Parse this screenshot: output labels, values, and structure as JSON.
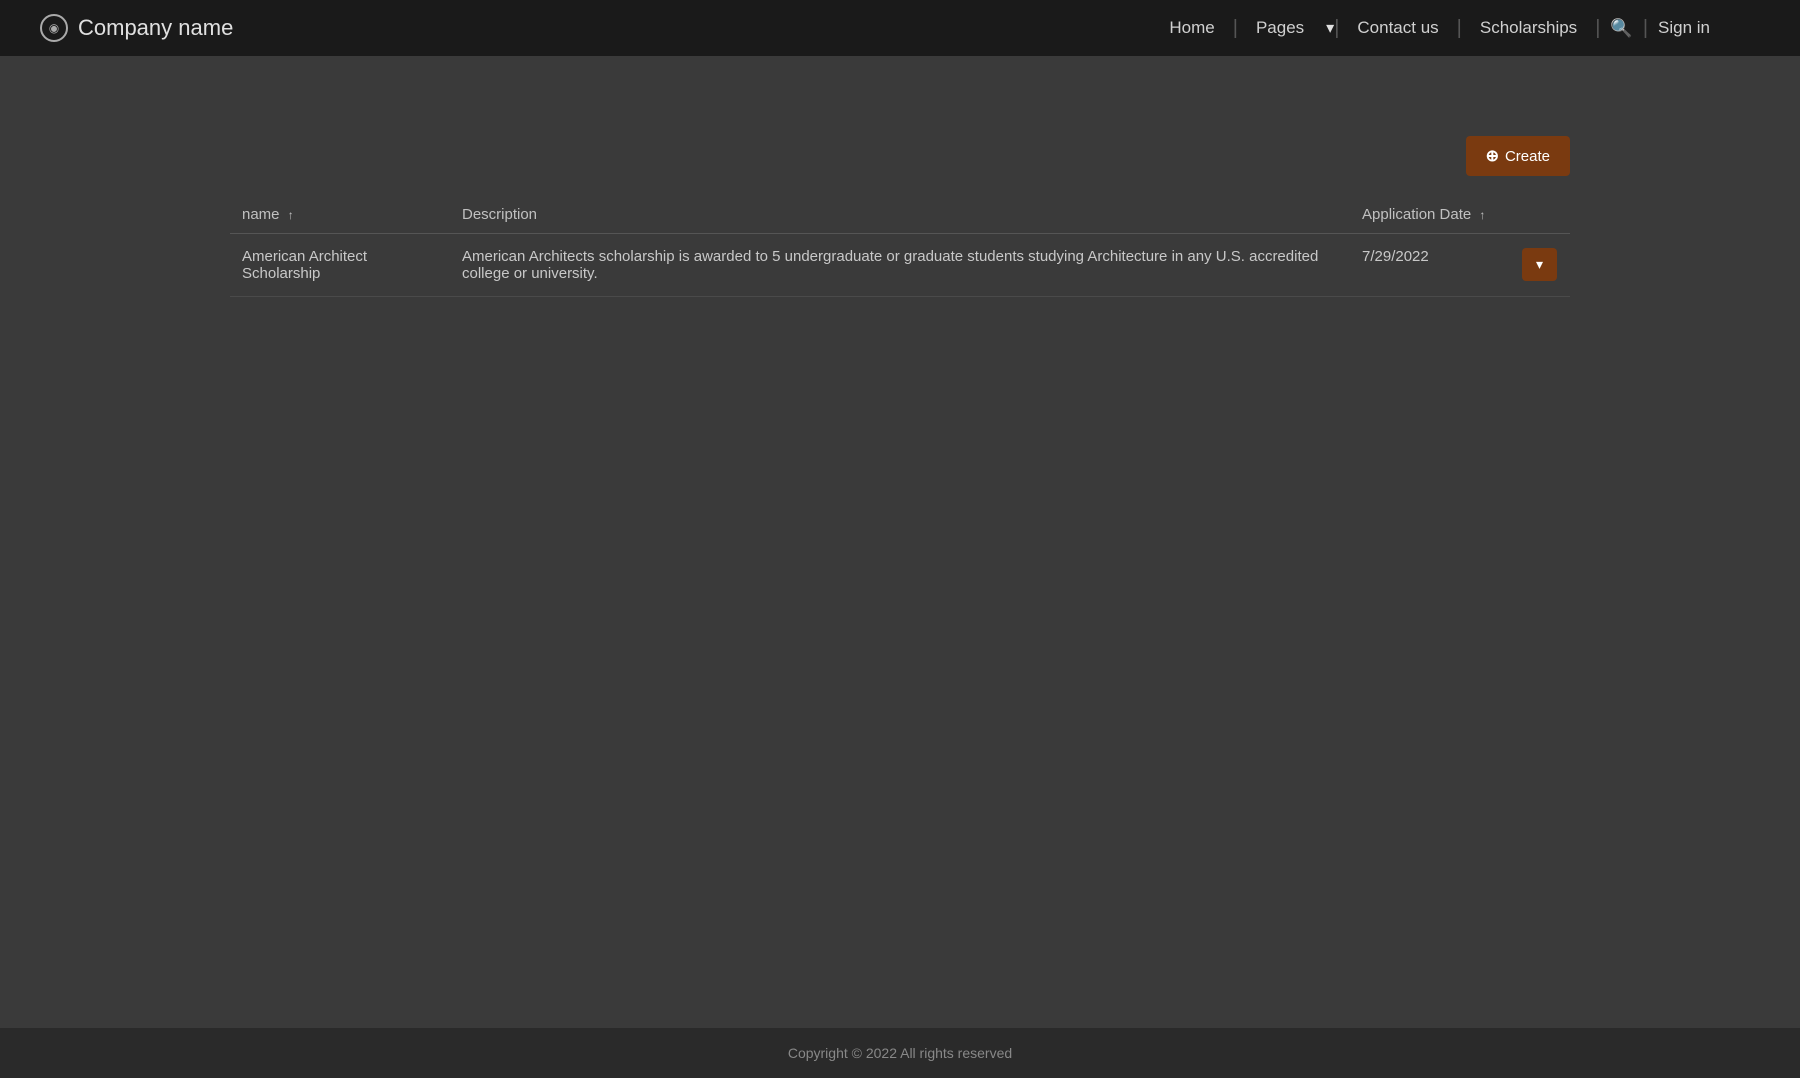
{
  "brand": {
    "name": "Company name",
    "icon": "◉"
  },
  "nav": {
    "home_label": "Home",
    "pages_label": "Pages",
    "pages_arrow": "▾",
    "contact_label": "Contact us",
    "scholarships_label": "Scholarships",
    "signin_label": "Sign in",
    "search_icon": "🔍"
  },
  "toolbar": {
    "create_label": "Create",
    "create_icon": "⊕"
  },
  "table": {
    "col_name": "name",
    "col_name_sort": "↑",
    "col_desc": "Description",
    "col_date": "Application Date",
    "col_date_sort": "↑",
    "rows": [
      {
        "name": "American Architect Scholarship",
        "description": "American Architects scholarship is awarded to 5 undergraduate or graduate students studying Architecture in any U.S. accredited college or university.",
        "date": "7/29/2022",
        "action": "▾"
      }
    ]
  },
  "footer": {
    "copyright": "Copyright © 2022  All rights reserved"
  }
}
